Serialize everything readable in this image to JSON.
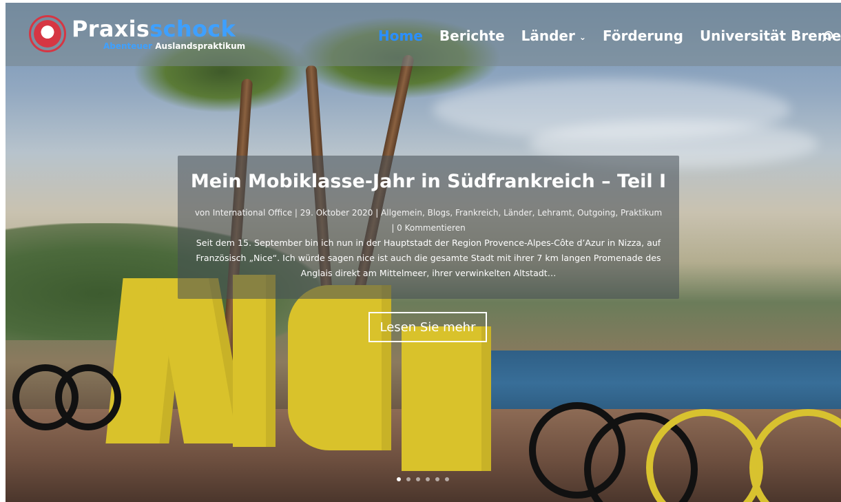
{
  "header": {
    "logo": {
      "title_prefix": "Praxis",
      "title_suffix": "schock",
      "subtitle_prefix": "Abenteuer",
      "subtitle_suffix": "Auslandspraktikum"
    },
    "nav": {
      "items": [
        {
          "label": "Home",
          "active": true,
          "has_submenu": false
        },
        {
          "label": "Berichte",
          "active": false,
          "has_submenu": false
        },
        {
          "label": "Länder",
          "active": false,
          "has_submenu": true
        },
        {
          "label": "Förderung",
          "active": false,
          "has_submenu": false
        },
        {
          "label": "Universität Bremen",
          "active": false,
          "has_submenu": false
        }
      ],
      "search_icon": "search-icon"
    }
  },
  "slide": {
    "title": "Mein Mobiklasse-Jahr in Südfrankreich – Teil I",
    "meta_line": "von International Office | 29. Oktober 2020 | Allgemein, Blogs, Frankreich, Länder, Lehramt, Outgoing, Praktikum | 0 Kommentieren",
    "excerpt": "Seit dem 15. September bin ich nun in der Hauptstadt der Region Provence-Alpes-Côte d’Azur in Nizza, auf Französisch „Nice“. Ich würde sagen nice ist auch die gesamte Stadt mit ihrer 7 km langen Promenade des Anglais direkt am Mittelmeer, ihrer verwinkelten Altstadt…",
    "cta_label": "Lesen Sie mehr"
  },
  "pagination": {
    "count": 6,
    "active_index": 0
  },
  "colors": {
    "accent": "#2a8fff",
    "logo_red": "#d63643",
    "logo_blue": "#3ea0ff"
  }
}
